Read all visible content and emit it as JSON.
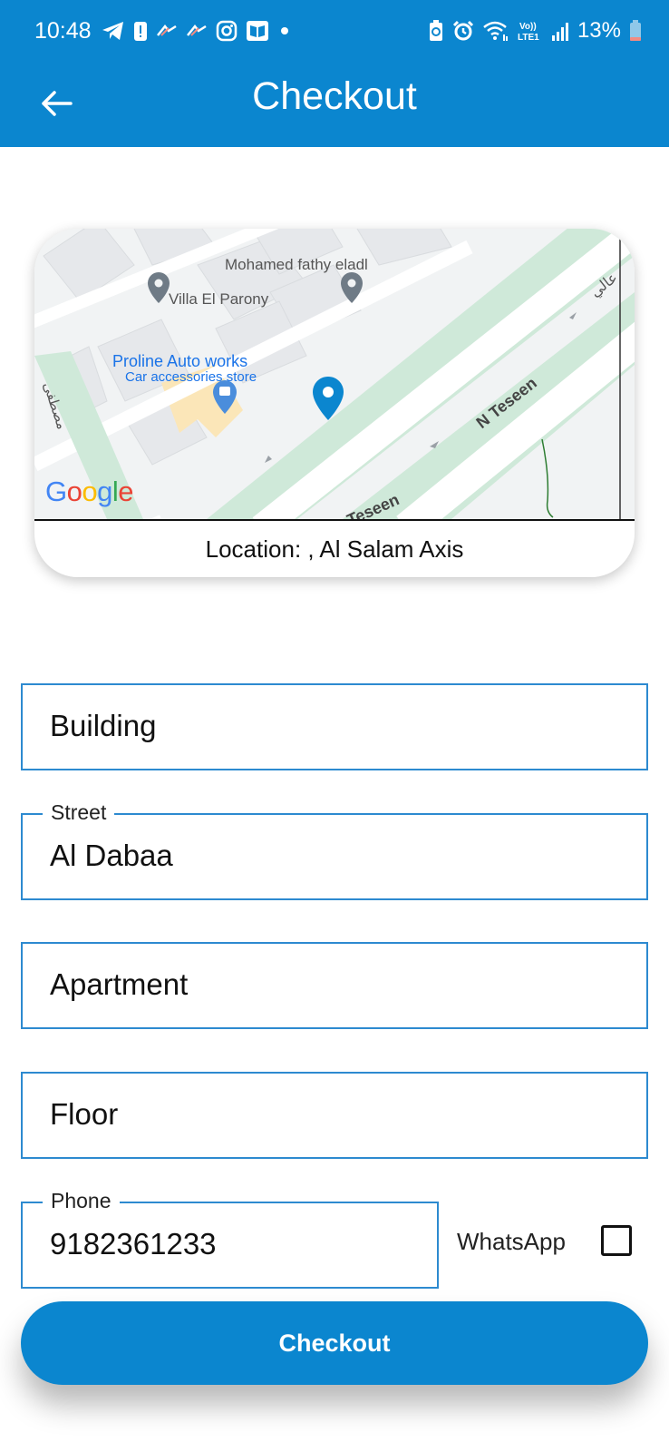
{
  "status_bar": {
    "time": "10:48",
    "battery": "13%",
    "network": "LTE1",
    "left_icons": [
      "telegram-icon",
      "alert-icon",
      "app-icon",
      "app-icon",
      "instagram-icon",
      "book-icon",
      "dot-icon"
    ],
    "right_icons": [
      "battery-saver-icon",
      "alarm-icon",
      "wifi-icon",
      "volte-icon",
      "signal-icon",
      "battery-icon"
    ]
  },
  "app_bar": {
    "title": "Checkout",
    "back_icon": "arrow-left-icon"
  },
  "map": {
    "labels": {
      "mohamed": "Mohamed fathy eladl",
      "villa": "Villa El Parony",
      "proline": "Proline Auto works",
      "proline_sub": "Car accessories store",
      "n_teseen": "N Teseen",
      "teseen_lower": "Teseen",
      "arabic_left": "مصطفى",
      "arabic_right": "عالي",
      "google": "Google"
    },
    "pin_icon": "location-pin-icon",
    "location_text": "Location: ,  Al Salam Axis"
  },
  "form": {
    "building": {
      "placeholder": "Building",
      "value": ""
    },
    "street": {
      "label": "Street",
      "value": "Al Dabaa"
    },
    "apartment": {
      "placeholder": "Apartment",
      "value": ""
    },
    "floor": {
      "placeholder": "Floor",
      "value": ""
    },
    "phone": {
      "label": "Phone",
      "value": "9182361233"
    },
    "whatsapp_label": "WhatsApp",
    "whatsapp_checked": false
  },
  "checkout_button": {
    "label": "Checkout"
  },
  "colors": {
    "primary": "#0b86cf",
    "field_border": "#2d8ad0",
    "park_green": "#cfe9d9",
    "map_bg": "#f1f3f4"
  }
}
